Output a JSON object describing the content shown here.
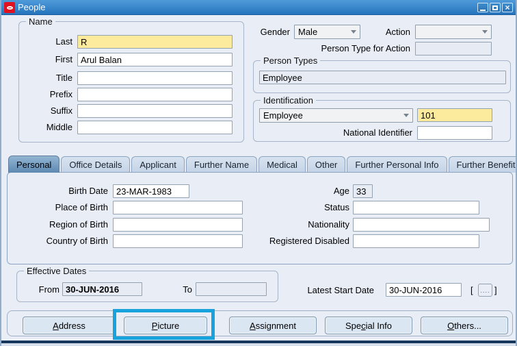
{
  "window": {
    "title": "People"
  },
  "name_section": {
    "legend": "Name",
    "fields": [
      {
        "label": "Last",
        "value": "R"
      },
      {
        "label": "First",
        "value": "Arul Balan"
      },
      {
        "label": "Title",
        "value": ""
      },
      {
        "label": "Prefix",
        "value": ""
      },
      {
        "label": "Suffix",
        "value": ""
      },
      {
        "label": "Middle",
        "value": ""
      }
    ]
  },
  "demographics": {
    "gender_label": "Gender",
    "gender_value": "Male",
    "action_label": "Action",
    "action_value": "",
    "person_type_for_action_label": "Person Type for Action",
    "person_type_for_action_value": ""
  },
  "person_types": {
    "legend": "Person Types",
    "value": "Employee"
  },
  "identification": {
    "legend": "Identification",
    "type_value": "Employee",
    "employee_number": "101",
    "national_identifier_label": "National Identifier",
    "national_identifier_value": ""
  },
  "tabs": [
    {
      "label": "Personal"
    },
    {
      "label": "Office Details"
    },
    {
      "label": "Applicant"
    },
    {
      "label": "Further Name"
    },
    {
      "label": "Medical"
    },
    {
      "label": "Other"
    },
    {
      "label": "Further Personal Info"
    },
    {
      "label": "Further Benefits"
    }
  ],
  "personal_tab": {
    "left_fields": [
      {
        "label": "Birth Date",
        "value": "23-MAR-1983"
      },
      {
        "label": "Place of Birth",
        "value": ""
      },
      {
        "label": "Region of Birth",
        "value": ""
      },
      {
        "label": "Country of Birth",
        "value": ""
      }
    ],
    "right_fields": [
      {
        "label": "Age",
        "value": "33"
      },
      {
        "label": "Status",
        "value": ""
      },
      {
        "label": "Nationality",
        "value": ""
      },
      {
        "label": "Registered Disabled",
        "value": ""
      }
    ]
  },
  "effective_dates": {
    "legend": "Effective Dates",
    "from_label": "From",
    "from_value": "30-JUN-2016",
    "to_label": "To",
    "to_value": ""
  },
  "latest_start_date": {
    "label": "Latest Start Date",
    "value": "30-JUN-2016",
    "bracket_left": "[",
    "bracket_right": "]",
    "lov_label": "...."
  },
  "footer_buttons": [
    {
      "pre": "",
      "mn": "A",
      "post": "ddress"
    },
    {
      "pre": "",
      "mn": "P",
      "post": "icture"
    },
    {
      "pre": "",
      "mn": "A",
      "post": "ssignment"
    },
    {
      "pre": "Spe",
      "mn": "c",
      "post": "ial Info"
    },
    {
      "pre": "",
      "mn": "O",
      "post": "thers..."
    }
  ],
  "colors": {
    "titlebar": "#2e7cc4",
    "required_field": "#fceb9c",
    "highlight": "#18a3dc"
  }
}
